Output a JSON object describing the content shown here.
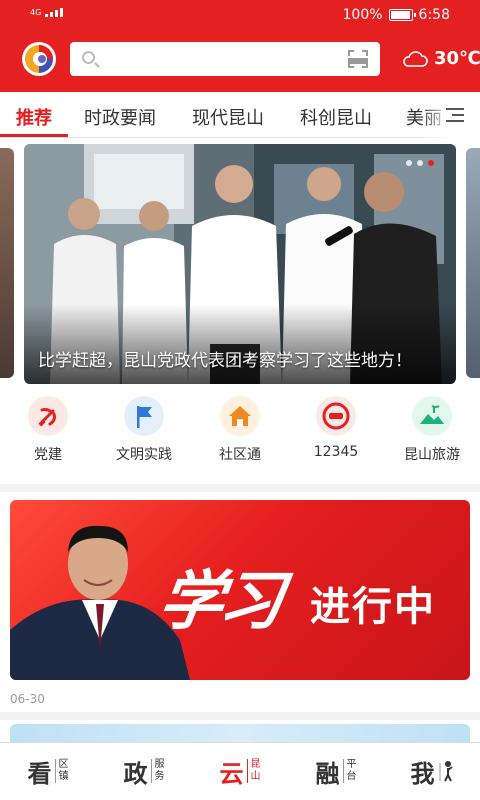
{
  "status_bar": {
    "network": "4G",
    "battery_text": "100%",
    "battery_level": 1.0,
    "time": "6:58"
  },
  "header": {
    "search": {
      "value": "",
      "placeholder": ""
    },
    "weather": {
      "icon": "cloud-icon",
      "temperature": "30℃"
    }
  },
  "tabs": [
    {
      "label": "推荐",
      "active": true
    },
    {
      "label": "时政要闻",
      "active": false
    },
    {
      "label": "现代昆山",
      "active": false
    },
    {
      "label": "科创昆山",
      "active": false
    },
    {
      "label": "美丽",
      "active": false
    }
  ],
  "carousel": {
    "caption": "比学赶超，昆山党政代表团考察学习了这些地方！",
    "slide_count": 3,
    "active_index": 2
  },
  "quick_links": [
    {
      "label": "党建",
      "icon": "party-emblem-icon"
    },
    {
      "label": "文明实践",
      "icon": "flag-icon"
    },
    {
      "label": "社区通",
      "icon": "home-icon"
    },
    {
      "label": "12345",
      "icon": "hotline-12345-icon"
    },
    {
      "label": "昆山旅游",
      "icon": "travel-icon"
    }
  ],
  "banner": {
    "calligraphy": "学习",
    "slogan": "进行中",
    "date": "06-30"
  },
  "bottom_nav": [
    {
      "big": "看",
      "small": [
        "区",
        "镇"
      ],
      "active": false
    },
    {
      "big": "政",
      "small": [
        "服",
        "务"
      ],
      "active": false
    },
    {
      "big": "云",
      "small": [
        "昆",
        "山"
      ],
      "active": true
    },
    {
      "big": "融",
      "small": [
        "平",
        "台"
      ],
      "active": false
    },
    {
      "big": "我",
      "small": [],
      "active": false
    }
  ],
  "colors": {
    "brand_red": "#e52020",
    "tab_text": "#333333",
    "date_text": "#999999"
  }
}
